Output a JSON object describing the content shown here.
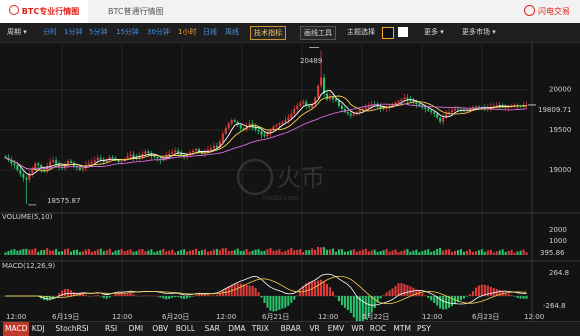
{
  "header": {
    "tab_pro": "BTC专业行情图",
    "tab_normal": "BTC普通行情图",
    "logo": "闪电交易"
  },
  "toolbar": {
    "period_label": "周期",
    "periods": [
      "分时",
      "1分钟",
      "5分钟",
      "15分钟",
      "30分钟",
      "1小时",
      "日线",
      "周线"
    ],
    "active_period": "1小时",
    "tech_btn": "技术指标",
    "draw_btn": "画线工具",
    "theme_label": "主题选择",
    "more": "更多",
    "more_markets": "更多市场"
  },
  "chart_data": {
    "type": "candlestick",
    "x_labels": [
      "12:00",
      "6月19日",
      "12:00",
      "6月20日",
      "12:00",
      "6月21日",
      "12:00",
      "6月22日",
      "12:00",
      "6月23日",
      "12:00"
    ],
    "price_ticks": [
      "20000",
      "19500",
      "19000"
    ],
    "ylim": [
      18500,
      20520
    ],
    "high_label": "20489",
    "low_label": "18575.87",
    "current_price": "19809.71",
    "volume_title": "VOLUME(5,10)",
    "volume_ticks": [
      "2000",
      "1000"
    ],
    "volume_current": "395.86",
    "macd_title": "MACD(12,26,9)",
    "macd_ticks": [
      "264.8",
      "-264.8"
    ],
    "close": [
      19150,
      19120,
      19080,
      19060,
      19000,
      18950,
      18900,
      18880,
      18960,
      19020,
      19080,
      19060,
      19010,
      18990,
      19040,
      19100,
      19120,
      19080,
      19040,
      19020,
      19070,
      19110,
      19090,
      19050,
      19030,
      19000,
      19020,
      19060,
      19080,
      19100,
      19120,
      19150,
      19130,
      19100,
      19120,
      19160,
      19150,
      19120,
      19100,
      19110,
      19140,
      19170,
      19190,
      19160,
      19140,
      19180,
      19200,
      19230,
      19210,
      19180,
      19160,
      19140,
      19120,
      19150,
      19180,
      19200,
      19220,
      19240,
      19210,
      19180,
      19160,
      19190,
      19220,
      19240,
      19260,
      19230,
      19200,
      19220,
      19250,
      19270,
      19300,
      19280,
      19350,
      19450,
      19520,
      19580,
      19620,
      19600,
      19560,
      19520,
      19500,
      19540,
      19580,
      19540,
      19500,
      19480,
      19440,
      19420,
      19460,
      19500,
      19540,
      19560,
      19580,
      19600,
      19620,
      19650,
      19700,
      19760,
      19800,
      19830,
      19850,
      19800,
      19780,
      19820,
      19900,
      20050,
      20150,
      19950,
      19880,
      19920,
      19880,
      19860,
      19800,
      19760,
      19720,
      19700,
      19680,
      19700,
      19720,
      19740,
      19760,
      19780,
      19800,
      19820,
      19810,
      19790,
      19770,
      19760,
      19780,
      19800,
      19820,
      19840,
      19860,
      19880,
      19900,
      19880,
      19860,
      19840,
      19820,
      19800,
      19780,
      19760,
      19740,
      19720,
      19700,
      19650,
      19600,
      19650,
      19700,
      19720,
      19740,
      19760,
      19750,
      19740,
      19730,
      19740,
      19760,
      19780,
      19790,
      19780,
      19770,
      19760,
      19780,
      19790,
      19800,
      19810,
      19800,
      19790,
      19780,
      19790,
      19800,
      19810,
      19800,
      19790,
      19800,
      19809.71
    ]
  },
  "indicators": [
    "MACD",
    "KDJ",
    "StochRSI",
    "RSI",
    "DMI",
    "OBV",
    "BOLL",
    "SAR",
    "DMA",
    "TRIX",
    "BRAR",
    "VR",
    "EMV",
    "WR",
    "ROC",
    "MTM",
    "PSY"
  ],
  "active_indicator": "MACD",
  "colors": {
    "up": "#e03b3b",
    "down": "#29c46b",
    "accent": "#e2231a",
    "ma5": "#ffffff",
    "ma10": "#f5d04a",
    "ma30": "#d86bd8"
  }
}
